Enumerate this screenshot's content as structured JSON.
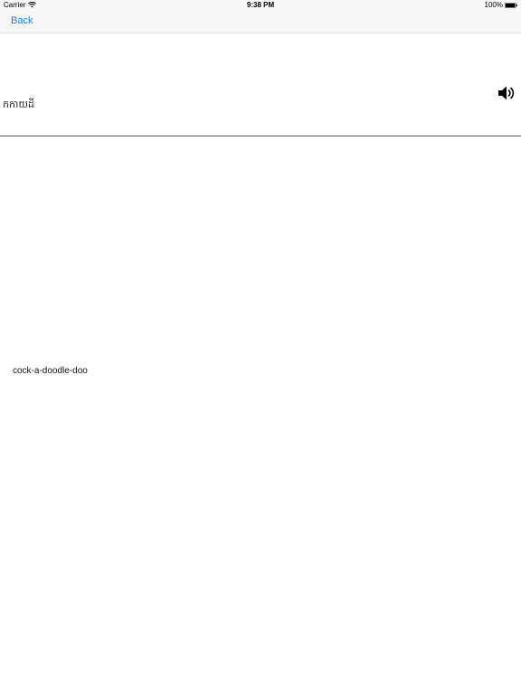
{
  "status_bar": {
    "carrier": "Carrier",
    "time": "9:38 PM",
    "battery_percent": "100%"
  },
  "nav": {
    "back_label": "Back"
  },
  "entry": {
    "word": "កកាយដី",
    "definition": "cock-a-doodle-doo"
  },
  "icons": {
    "wifi": "wifi-icon",
    "battery": "battery-icon",
    "speaker": "speaker-icon"
  }
}
